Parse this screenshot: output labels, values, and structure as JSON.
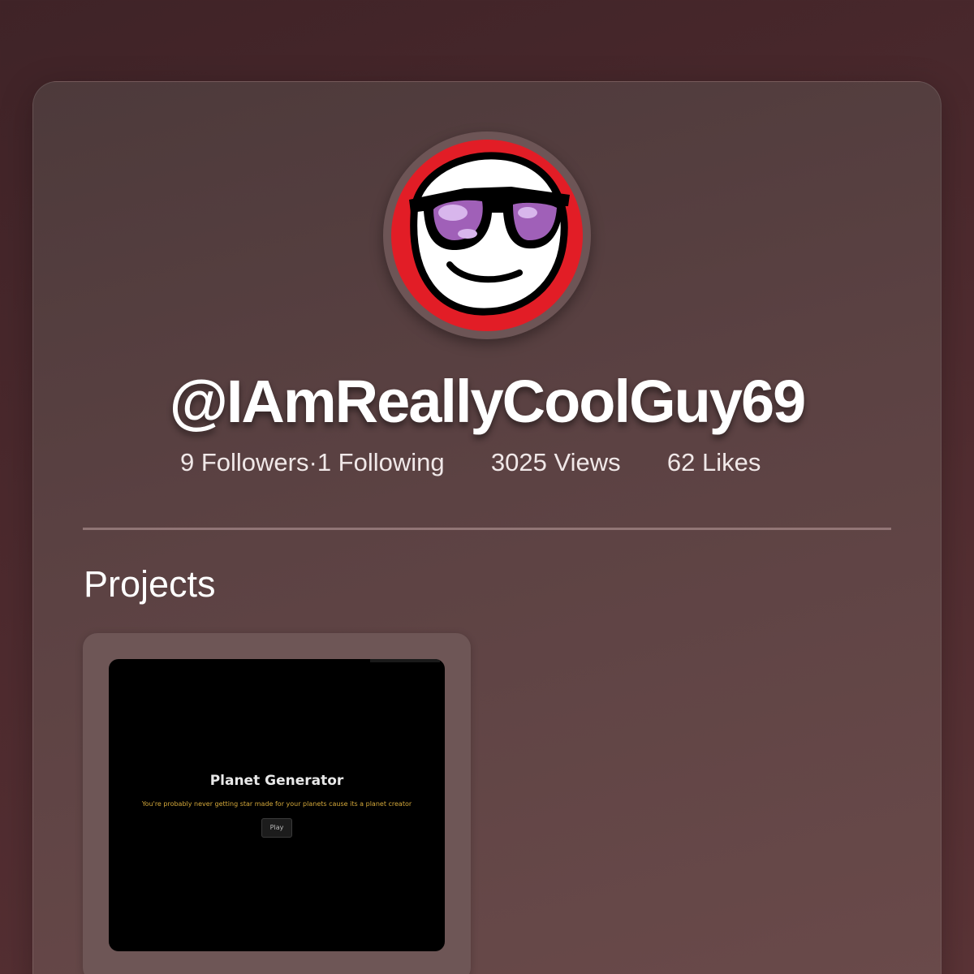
{
  "profile": {
    "username": "@IAmReallyCoolGuy69",
    "avatar_icon": "sunglasses-face-icon",
    "stats": {
      "followers": "9 Followers",
      "separator": " · ",
      "following": "1 Following",
      "views": "3025 Views",
      "likes": "62 Likes"
    }
  },
  "projects": {
    "heading": "Projects",
    "items": [
      {
        "title": "Planet Generator",
        "subtitle": "You're probably never getting star made for your planets cause its a planet creator",
        "play_label": "Play"
      }
    ]
  },
  "colors": {
    "background": "#4d2a2e",
    "card": "#5c4243",
    "avatar_ring": "#e21d26",
    "subtitle": "#d4a83a"
  }
}
